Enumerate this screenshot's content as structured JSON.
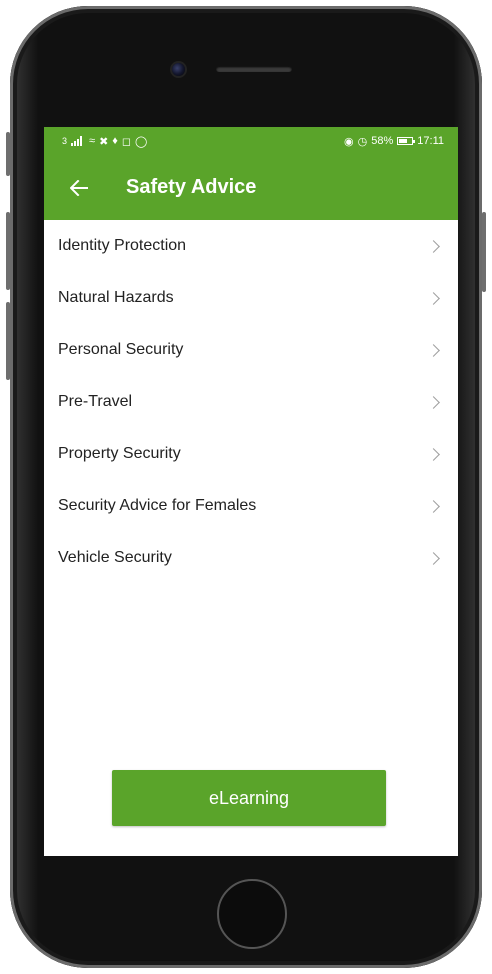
{
  "status_bar": {
    "left_text": "3",
    "battery_percent": "58%",
    "time": "17:11",
    "icons": [
      "signal-icon",
      "wifi-icon",
      "nfc-icon",
      "usb-icon",
      "instagram-icon",
      "whatsapp-icon",
      "eye-icon",
      "alarm-icon",
      "battery-icon"
    ]
  },
  "app_bar": {
    "back_icon": "arrow-left-icon",
    "title": "Safety Advice",
    "color": "#5aa42a"
  },
  "menu": {
    "items": [
      {
        "label": "Identity Protection"
      },
      {
        "label": "Natural Hazards"
      },
      {
        "label": "Personal Security"
      },
      {
        "label": "Pre-Travel"
      },
      {
        "label": "Property Security"
      },
      {
        "label": "Security Advice for Females"
      },
      {
        "label": "Vehicle Security"
      }
    ],
    "chevron_icon": "chevron-right-icon"
  },
  "footer": {
    "button_label": "eLearning"
  }
}
